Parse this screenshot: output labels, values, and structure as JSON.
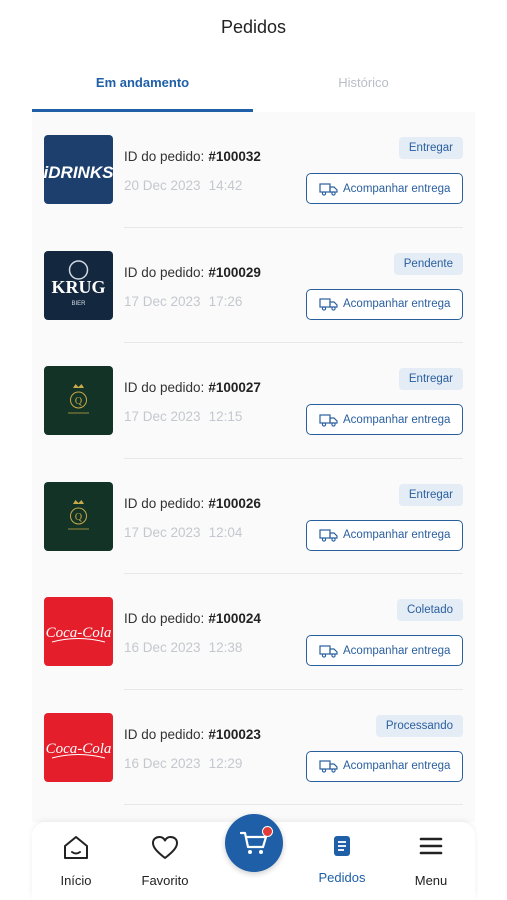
{
  "header": {
    "title": "Pedidos"
  },
  "tabs": [
    {
      "label": "Em andamento",
      "active": true
    },
    {
      "label": "Histórico",
      "active": false
    }
  ],
  "orders": [
    {
      "store": "iDRINKS",
      "logo": "idrinks",
      "id_label": "ID do pedido:",
      "id": "#100032",
      "date": "20 Dec 2023",
      "time": "14:42",
      "status": "Entregar",
      "track_label": "Acompanhar entrega"
    },
    {
      "store": "KRUG BIER",
      "logo": "krug",
      "id_label": "ID do pedido:",
      "id": "#100029",
      "date": "17 Dec 2023",
      "time": "17:26",
      "status": "Pendente",
      "track_label": "Acompanhar entrega"
    },
    {
      "store": "Q",
      "logo": "q",
      "id_label": "ID do pedido:",
      "id": "#100027",
      "date": "17 Dec 2023",
      "time": "12:15",
      "status": "Entregar",
      "track_label": "Acompanhar entrega"
    },
    {
      "store": "Q",
      "logo": "q",
      "id_label": "ID do pedido:",
      "id": "#100026",
      "date": "17 Dec 2023",
      "time": "12:04",
      "status": "Entregar",
      "track_label": "Acompanhar entrega"
    },
    {
      "store": "Coca-Cola",
      "logo": "coca",
      "id_label": "ID do pedido:",
      "id": "#100024",
      "date": "16 Dec 2023",
      "time": "12:38",
      "status": "Coletado",
      "track_label": "Acompanhar entrega"
    },
    {
      "store": "Coca-Cola",
      "logo": "coca",
      "id_label": "ID do pedido:",
      "id": "#100023",
      "date": "16 Dec 2023",
      "time": "12:29",
      "status": "Processando",
      "track_label": "Acompanhar entrega"
    }
  ],
  "nav": {
    "items": [
      {
        "label": "Início",
        "icon": "home-icon"
      },
      {
        "label": "Favorito",
        "icon": "heart-icon"
      },
      {
        "label": "Pedidos",
        "icon": "orders-icon",
        "active": true
      },
      {
        "label": "Menu",
        "icon": "menu-icon"
      }
    ],
    "cart_icon": "cart-icon"
  },
  "colors": {
    "accent": "#1e5fa8",
    "badge_bg": "#e4ecf5",
    "coca_red": "#e41e2b",
    "idrinks_blue": "#1d3f6e",
    "q_green": "#123325",
    "krug_navy": "#13283e"
  }
}
